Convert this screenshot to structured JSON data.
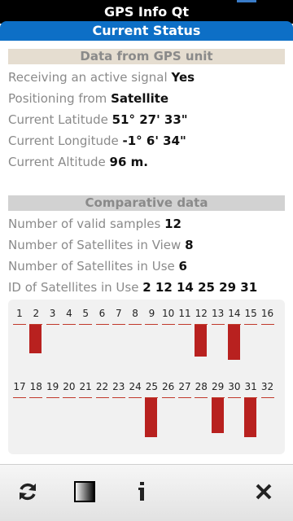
{
  "app": {
    "title": "GPS Info Qt",
    "subtitle": "Current Status"
  },
  "gps": {
    "header": "Data from GPS unit",
    "rows": [
      {
        "label": "Receiving an active signal",
        "value": "Yes"
      },
      {
        "label": "Positioning from",
        "value": "Satellite"
      },
      {
        "label": "Current Latitude",
        "value": "51° 27' 33\""
      },
      {
        "label": "Current Longitude",
        "value": "-1° 6' 34\""
      },
      {
        "label": "Current Altitude",
        "value": "96 m."
      }
    ]
  },
  "comparative": {
    "header": "Comparative data",
    "rows": [
      {
        "label": "Number of valid samples",
        "value": "12"
      },
      {
        "label": "Number of Satellites in View",
        "value": "8"
      },
      {
        "label": "Number of Satellites in Use",
        "value": "6"
      },
      {
        "label": "ID of Satellites in Use",
        "value": "2 12 14 25 29 31"
      }
    ]
  },
  "chart_data": {
    "type": "bar",
    "title": "",
    "categories": [
      "1",
      "2",
      "3",
      "4",
      "5",
      "6",
      "7",
      "8",
      "9",
      "10",
      "11",
      "12",
      "13",
      "14",
      "15",
      "16",
      "17",
      "18",
      "19",
      "20",
      "21",
      "22",
      "23",
      "24",
      "25",
      "26",
      "27",
      "28",
      "29",
      "30",
      "31",
      "32"
    ],
    "series": [
      {
        "values": [
          0,
          0.8,
          0,
          0,
          0,
          0,
          0,
          0,
          0,
          0,
          0,
          0.9,
          0,
          1.0,
          0,
          0,
          0,
          0,
          0,
          0,
          0,
          0,
          0,
          0,
          1.1,
          0,
          0,
          0,
          1.0,
          0,
          1.1,
          0
        ]
      }
    ],
    "ylim": [
      0,
      1.2
    ],
    "grid": false
  },
  "toolbar": {
    "refresh_icon": "refresh-icon",
    "contrast_icon": "contrast-icon",
    "info_icon": "info-icon",
    "close_icon": "close-icon"
  }
}
